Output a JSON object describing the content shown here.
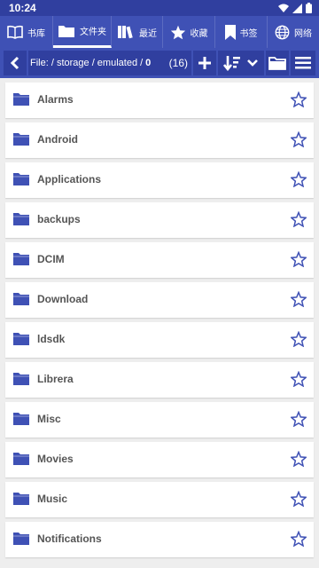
{
  "status": {
    "time": "10:24"
  },
  "tabs": [
    {
      "label": "书库",
      "icon": "book-open-icon"
    },
    {
      "label": "文件夹",
      "icon": "folder-icon",
      "active": true
    },
    {
      "label": "最近",
      "icon": "books-icon"
    },
    {
      "label": "收藏",
      "icon": "star-icon"
    },
    {
      "label": "书签",
      "icon": "bookmark-icon"
    },
    {
      "label": "网络",
      "icon": "globe-icon"
    }
  ],
  "path": {
    "prefix": "File: / storage / emulated /",
    "current": "0",
    "count": "(16)"
  },
  "files": [
    {
      "name": "Alarms"
    },
    {
      "name": "Android"
    },
    {
      "name": "Applications"
    },
    {
      "name": "backups"
    },
    {
      "name": "DCIM"
    },
    {
      "name": "Download"
    },
    {
      "name": "ldsdk"
    },
    {
      "name": "Librera"
    },
    {
      "name": "Misc"
    },
    {
      "name": "Movies"
    },
    {
      "name": "Music"
    },
    {
      "name": "Notifications"
    }
  ],
  "colors": {
    "primary": "#3f51b5",
    "primary_dark": "#303f9f",
    "folder": "#3f51b5",
    "text": "#555555"
  }
}
